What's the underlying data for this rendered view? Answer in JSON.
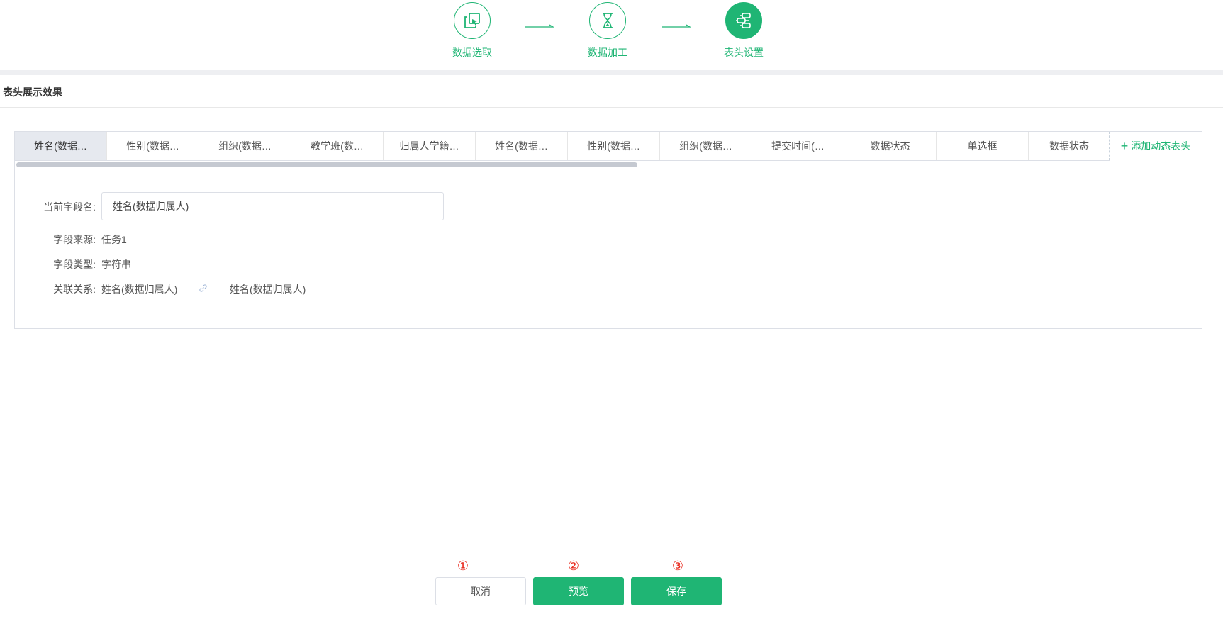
{
  "steps": [
    {
      "label": "数据选取",
      "icon": "copy-cursor-icon"
    },
    {
      "label": "数据加工",
      "icon": "hourglass-icon"
    },
    {
      "label": "表头设置",
      "icon": "flow-settings-icon",
      "active": true
    }
  ],
  "section": {
    "title": "表头展示效果"
  },
  "header_tabs": [
    "姓名(数据…",
    "性别(数据…",
    "组织(数据…",
    "教学班(数…",
    "归属人学籍…",
    "姓名(数据…",
    "性别(数据…",
    "组织(数据…",
    "提交时间(…",
    "数据状态",
    "单选框",
    "数据状态"
  ],
  "add_header_label": "添加动态表头",
  "field": {
    "name_label": "当前字段名:",
    "name_value": "姓名(数据归属人)",
    "source_label": "字段来源:",
    "source_value": "任务1",
    "type_label": "字段类型:",
    "type_value": "字符串",
    "relation_label": "关联关系:",
    "relation_left": "姓名(数据归属人)",
    "relation_right": "姓名(数据归属人)"
  },
  "buttons": {
    "cancel": "取消",
    "preview": "预览",
    "save": "保存"
  },
  "markers": [
    "①",
    "②",
    "③"
  ],
  "colors": {
    "accent": "#1fb574",
    "marker": "#e8261a"
  }
}
